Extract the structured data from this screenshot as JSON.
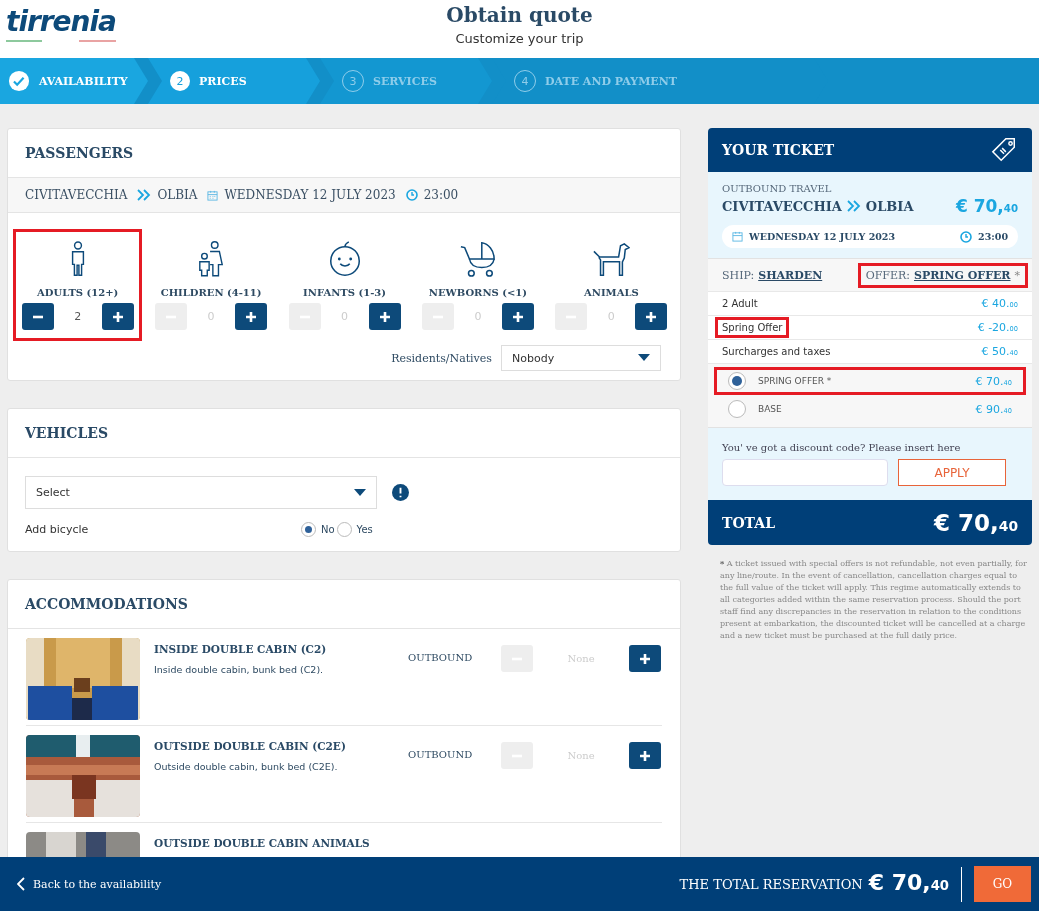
{
  "header": {
    "logo": "tirrenia",
    "title": "Obtain quote",
    "subtitle": "Customize your trip"
  },
  "steps": [
    {
      "label": "AVAILABILITY",
      "done": true,
      "selected": false
    },
    {
      "number": "2",
      "label": "PRICES",
      "done": false,
      "selected": true
    },
    {
      "number": "3",
      "label": "SERVICES",
      "done": false,
      "selected": false
    },
    {
      "number": "4",
      "label": "DATE AND PAYMENT",
      "done": false,
      "selected": false
    }
  ],
  "passengers": {
    "title": "PASSENGERS",
    "from": "CIVITAVECCHIA",
    "to": "OLBIA",
    "date": "WEDNESDAY 12 JULY 2023",
    "time": "23:00",
    "types": [
      {
        "kind": "adult",
        "label": "ADULTS (12+)",
        "count": "2",
        "minus_disabled": false,
        "highlighted": true
      },
      {
        "kind": "child",
        "label": "CHILDREN (4-11)",
        "count": "0",
        "minus_disabled": true,
        "highlighted": false
      },
      {
        "kind": "infant",
        "label": "INFANTS (1-3)",
        "count": "0",
        "minus_disabled": true,
        "highlighted": false
      },
      {
        "kind": "newborn",
        "label": "NEWBORNS (<1)",
        "count": "0",
        "minus_disabled": true,
        "highlighted": false
      },
      {
        "kind": "animal",
        "label": "ANIMALS",
        "count": "0",
        "minus_disabled": true,
        "highlighted": false
      }
    ],
    "residents_label": "Residents/Natives",
    "residents_value": "Nobody"
  },
  "vehicles": {
    "title": "VEHICLES",
    "select": "Select",
    "bicycle_label": "Add bicycle",
    "options": [
      {
        "label": "No",
        "selected": true
      },
      {
        "label": "Yes",
        "selected": false
      }
    ]
  },
  "accommodations": {
    "title": "ACCOMMODATIONS",
    "items": [
      {
        "name": "INSIDE DOUBLE CABIN (C2)",
        "description": "Inside double cabin, bunk bed (C2).",
        "direction": "OUTBOUND",
        "quantity": "None"
      },
      {
        "name": "OUTSIDE DOUBLE CABIN (C2E)",
        "description": "Outside double cabin, bunk bed (C2E).",
        "direction": "OUTBOUND",
        "quantity": "None"
      },
      {
        "name": "OUTSIDE DOUBLE CABIN ANIMALS"
      }
    ]
  },
  "ticket": {
    "title": "YOUR TICKET",
    "direction": "OUTBOUND TRAVEL",
    "from": "CIVITAVECCHIA",
    "to": "OLBIA",
    "price": {
      "main": "€ 70,",
      "cents": "40"
    },
    "date": "WEDNESDAY 12 JULY 2023",
    "time": "23:00",
    "ship_label": "SHIP:",
    "ship": "SHARDEN",
    "offer_label": "OFFER:",
    "offer": "SPRING OFFER",
    "offer_mark": "*",
    "offer_highlighted": true,
    "lines": [
      {
        "label": "2 Adult",
        "main": "€ 40.",
        "cents": "00",
        "highlighted": false
      },
      {
        "label": "Spring Offer",
        "main": "€ -20.",
        "cents": "00",
        "highlighted": true
      },
      {
        "label": "Surcharges and taxes",
        "main": "€ 50.",
        "cents": "40",
        "highlighted": false
      }
    ],
    "fares": [
      {
        "label": "SPRING OFFER *",
        "main": "€ 70.",
        "cents": "40",
        "selected": true,
        "highlighted": true
      },
      {
        "label": "BASE",
        "main": "€ 90.",
        "cents": "40",
        "selected": false,
        "highlighted": false
      }
    ],
    "discount_prompt": "You' ve got a discount code? Please insert here",
    "apply": "APPLY",
    "total_label": "TOTAL",
    "total": {
      "main": "€ 70,",
      "cents": "40"
    }
  },
  "note_mark": "*",
  "note": "A ticket issued with special offers is not refundable, not even partially, for any line/route. In the event of cancellation, cancellation charges equal to the full value of the ticket will apply. This regime automatically extends to all categories added within the same reservation process. Should the port staff find any discrepancies in the reservation in relation to the conditions present at embarkation, the discounted ticket will be cancelled at a charge and a new ticket must be purchased at the full daily price.",
  "footer": {
    "back": "Back to the availability",
    "total_label": "THE TOTAL RESERVATION",
    "total": {
      "main": "€ 70,",
      "cents": "40"
    },
    "go": "GO"
  }
}
